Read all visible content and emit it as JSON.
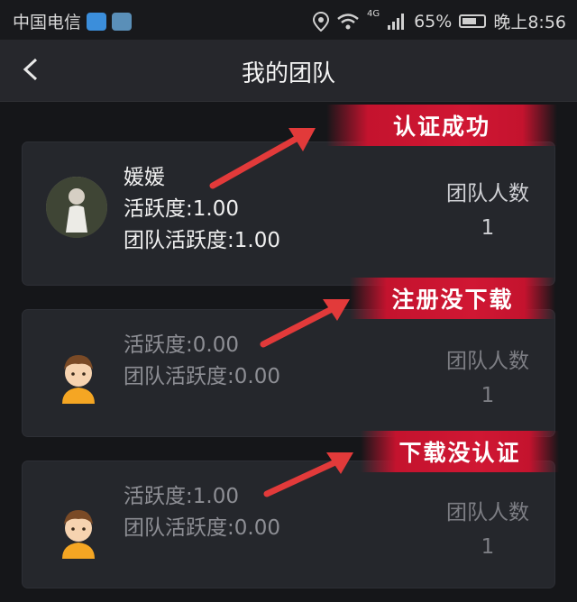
{
  "status_bar": {
    "carrier": "中国电信",
    "network": "4G",
    "battery": "65%",
    "battery_level": 0.65,
    "time": "晚上8:56"
  },
  "nav": {
    "title": "我的团队",
    "back_icon": "chevron-left-icon"
  },
  "members": [
    {
      "name": "媛媛",
      "activity": "活跃度:1.00",
      "team_activity": "团队活跃度:1.00",
      "team_label": "团队人数",
      "team_count": "1",
      "annotation": "认证成功"
    },
    {
      "name": "",
      "activity": "活跃度:0.00",
      "team_activity": "团队活跃度:0.00",
      "team_label": "团队人数",
      "team_count": "1",
      "annotation": "注册没下载"
    },
    {
      "name": "",
      "activity": "活跃度:1.00",
      "team_activity": "团队活跃度:0.00",
      "team_label": "团队人数",
      "team_count": "1",
      "annotation": "下载没认证"
    }
  ],
  "colors": {
    "annotation_red": "#d01733",
    "arrow_red": "#e23a3a",
    "card_bg": "#25272c"
  }
}
